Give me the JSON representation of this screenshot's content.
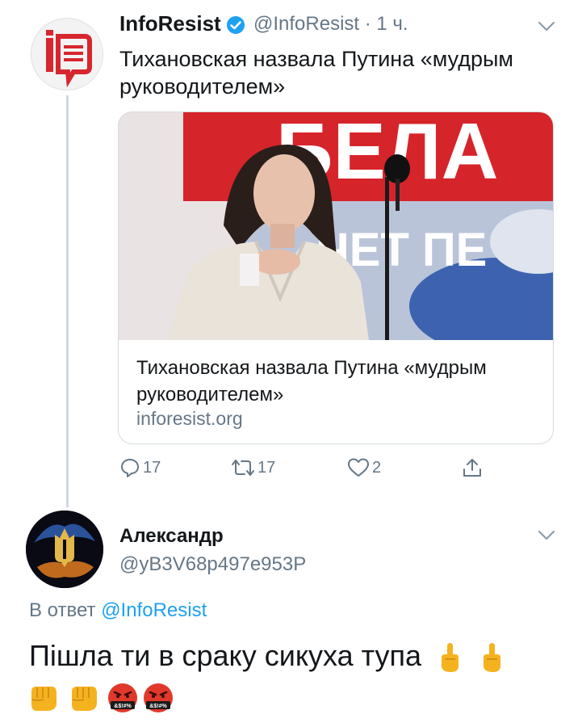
{
  "tweet": {
    "display_name": "InfoResist",
    "handle_time": "@InfoResist · 1 ч.",
    "text": "Тихановская назвала Путина «мудрым руководителем»",
    "card": {
      "title": "Тихановская назвала Путина «мудрым руководителем»",
      "domain": "inforesist.org",
      "image_banner_text_1": "БЕЛА",
      "image_banner_text_2": "ЧЕТ ПЕ"
    },
    "actions": {
      "replies": "17",
      "retweets": "17",
      "likes": "2"
    }
  },
  "reply": {
    "display_name": "Александр",
    "handle": "@yB3V68p497e953P",
    "reply_prefix": "В ответ",
    "reply_mention": "@InfoResist",
    "text": "Пішла ти в сраку сикуха тупа",
    "angry_face_label": "&$!#%"
  },
  "colors": {
    "text": "#14171a",
    "secondary": "#657786",
    "link": "#1da1f2",
    "verified": "#1da1f2",
    "divider": "#cfd9de"
  },
  "icons": [
    "verified-badge-icon",
    "chevron-down-icon",
    "reply-icon",
    "retweet-icon",
    "like-icon",
    "share-icon",
    "middle-finger-emoji",
    "fist-emoji",
    "cursing-face-emoji"
  ]
}
